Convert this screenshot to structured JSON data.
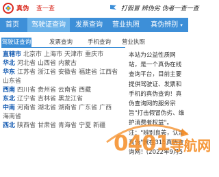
{
  "header": {
    "logo_text": "真伪",
    "logo_sub": "查一查",
    "slogan": "打假冒 辨伪劣 伪者一查一查"
  },
  "nav": {
    "items": [
      {
        "label": "首页",
        "active": false
      },
      {
        "label": "驾驶证查询",
        "active": true
      },
      {
        "label": "发票查询",
        "active": false
      },
      {
        "label": "营业执照",
        "active": false
      },
      {
        "label": "真伪辨别",
        "active": false,
        "caret": "▾"
      }
    ]
  },
  "tabs": [
    {
      "label": "驾驶证查询",
      "active": true
    },
    {
      "label": "发票查询",
      "active": false
    },
    {
      "label": "手机查询",
      "active": false
    },
    {
      "label": "营业执照",
      "active": false
    }
  ],
  "regions": [
    {
      "name": "直辖市",
      "cities": [
        "北京市",
        "上海市",
        "天津市",
        "重庆市"
      ]
    },
    {
      "name": "华北",
      "cities": [
        "河北省",
        "山西省",
        "内蒙古"
      ]
    },
    {
      "name": "华东",
      "cities": [
        "江苏省",
        "浙江省",
        "安徽省",
        "福建省",
        "江西省",
        "山东省"
      ]
    },
    {
      "name": "西南",
      "cities": [
        "四川省",
        "贵州省",
        "云南省",
        "西藏"
      ]
    },
    {
      "name": "东北",
      "cities": [
        "辽宁省",
        "吉林省",
        "黑龙江省"
      ]
    },
    {
      "name": "中南",
      "cities": [
        "河南省",
        "湖北省",
        "湖南省",
        "广东省",
        "广西",
        "海南省"
      ]
    },
    {
      "name": "西北",
      "cities": [
        "陕西省",
        "甘肃省",
        "青海省",
        "宁夏",
        "新疆"
      ]
    }
  ],
  "notice": {
    "p1": "本站为公益性质网站，是一个真伪在线查询平台，目前主要提供驾驶证、发票和手机的真伪查询！真伪查询网的服务宗旨\"打击假冒伪劣、维护消费者权益\"。",
    "p2": "注：\"辨别良莠，认清真伪\"就在315真伪查询网！(2022年9月5"
  },
  "watermark": {
    "main": "0401",
    "sub": "导航网"
  },
  "colors": {
    "nav_bg": "#3d8fd8",
    "nav_active": "#6ab2ea",
    "region_name": "#1a5fb4",
    "watermark": "#f48c24",
    "logo": "#d9271c"
  }
}
